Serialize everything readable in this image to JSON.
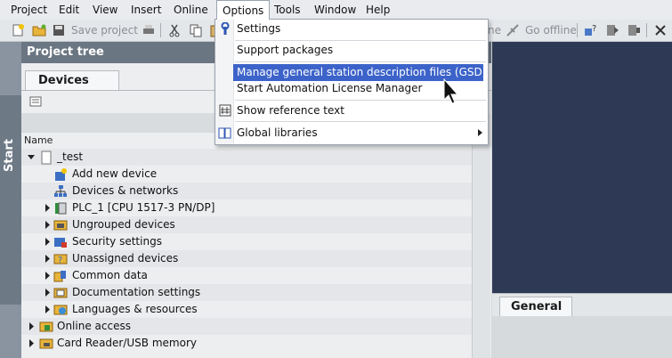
{
  "menubar": {
    "items": [
      "Project",
      "Edit",
      "View",
      "Insert",
      "Online",
      "Options",
      "Tools",
      "Window",
      "Help"
    ]
  },
  "toolbar": {
    "save_project": "Save project",
    "go_offline": "Go offline",
    "partial": "ne"
  },
  "options_menu": {
    "items": [
      {
        "label": "Settings",
        "icon": "wrench-icon"
      },
      {
        "label": "Support packages"
      },
      {
        "label": "Manage general station description files (GSD)"
      },
      {
        "label": "Start Automation License Manager"
      },
      {
        "label": "Show reference text",
        "icon": "reference-text-icon"
      },
      {
        "label": "Global libraries",
        "icon": "book-icon"
      }
    ]
  },
  "start_bar": {
    "label": "Start"
  },
  "project_tree": {
    "header": "Project tree",
    "tab": "Devices",
    "column": "Name",
    "rows": [
      {
        "label": "_test"
      },
      {
        "label": "Add new device"
      },
      {
        "label": "Devices & networks"
      },
      {
        "label": "PLC_1 [CPU 1517-3 PN/DP]"
      },
      {
        "label": "Ungrouped devices"
      },
      {
        "label": "Security settings"
      },
      {
        "label": "Unassigned devices"
      },
      {
        "label": "Common data"
      },
      {
        "label": "Documentation settings"
      },
      {
        "label": "Languages & resources"
      },
      {
        "label": "Online access"
      },
      {
        "label": "Card Reader/USB memory"
      }
    ]
  },
  "properties": {
    "tab": "General"
  },
  "colors": {
    "highlight": "#3c63c9",
    "portal_dark": "#2e3a55",
    "header": "#6b7683"
  }
}
